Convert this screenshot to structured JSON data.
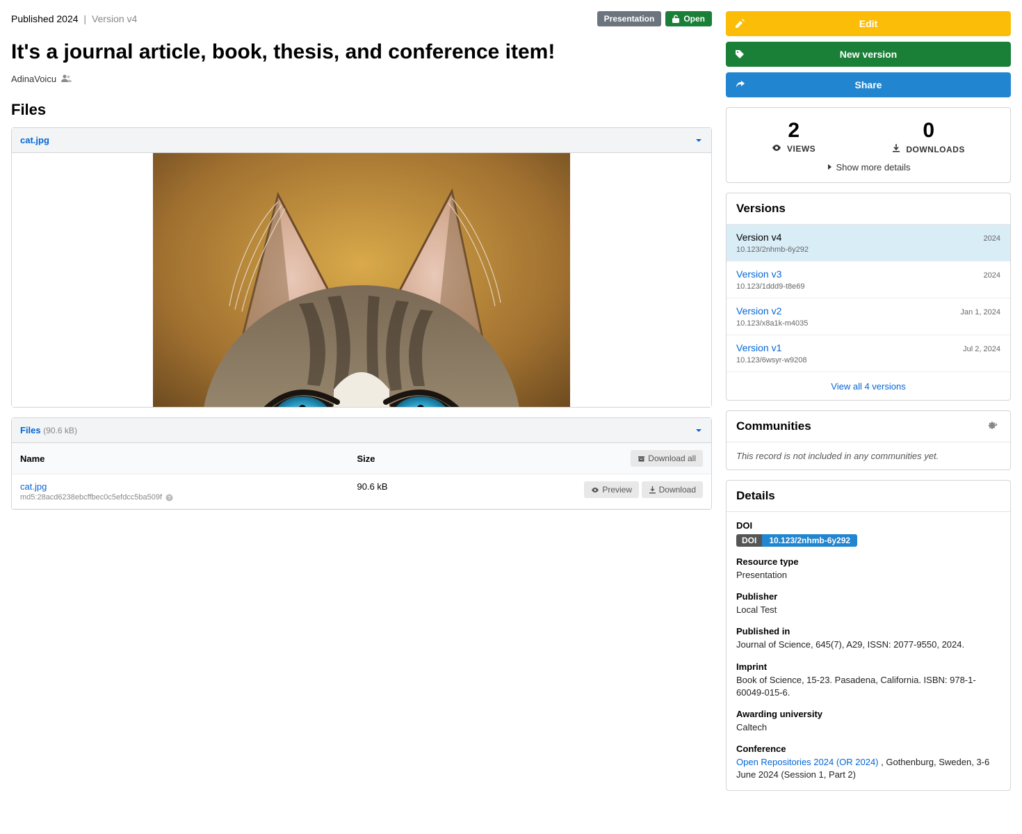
{
  "header": {
    "published_text": "Published 2024",
    "version_text": "Version v4",
    "badges": {
      "resource_type": "Presentation",
      "access": "Open"
    },
    "title": "It's a journal article, book, thesis, and conference item!",
    "author": "AdinaVoicu"
  },
  "files_heading": "Files",
  "preview": {
    "filename": "cat.jpg"
  },
  "files_panel": {
    "label": "Files",
    "total_size": "(90.6 kB)",
    "cols": {
      "name": "Name",
      "size": "Size",
      "download_all": "Download all"
    },
    "rows": [
      {
        "name": "cat.jpg",
        "md5": "md5:28acd6238ebcffbec0c5efdcc5ba509f",
        "size": "90.6 kB"
      }
    ],
    "preview_btn": "Preview",
    "download_btn": "Download"
  },
  "actions": {
    "edit": "Edit",
    "new_version": "New version",
    "share": "Share"
  },
  "stats": {
    "views_num": "2",
    "views_label": "VIEWS",
    "downloads_num": "0",
    "downloads_label": "DOWNLOADS",
    "show_more": "Show more details"
  },
  "versions": {
    "heading": "Versions",
    "items": [
      {
        "label": "Version v4",
        "date": "2024",
        "doi": "10.123/2nhmb-6y292",
        "active": true
      },
      {
        "label": "Version v3",
        "date": "2024",
        "doi": "10.123/1ddd9-t8e69",
        "active": false
      },
      {
        "label": "Version v2",
        "date": "Jan 1, 2024",
        "doi": "10.123/x8a1k-m4035",
        "active": false
      },
      {
        "label": "Version v1",
        "date": "Jul 2, 2024",
        "doi": "10.123/6wsyr-w9208",
        "active": false
      }
    ],
    "view_all": "View all 4 versions"
  },
  "communities": {
    "heading": "Communities",
    "empty": "This record is not included in any communities yet."
  },
  "details": {
    "heading": "Details",
    "items": [
      {
        "k": "DOI",
        "type": "doi",
        "doi_label": "DOI",
        "doi_value": "10.123/2nhmb-6y292"
      },
      {
        "k": "Resource type",
        "v": "Presentation"
      },
      {
        "k": "Publisher",
        "v": "Local Test"
      },
      {
        "k": "Published in",
        "v": "Journal of Science, 645(7), A29, ISSN: 2077-9550, 2024."
      },
      {
        "k": "Imprint",
        "v": "Book of Science, 15-23. Pasadena, California. ISBN: 978-1-60049-015-6."
      },
      {
        "k": "Awarding university",
        "v": "Caltech"
      },
      {
        "k": "Conference",
        "type": "conference",
        "link_text": "Open Repositories 2024 (OR 2024)",
        "tail": " , Gothenburg, Sweden, 3-6 June 2024 (Session 1, Part 2)"
      }
    ]
  }
}
